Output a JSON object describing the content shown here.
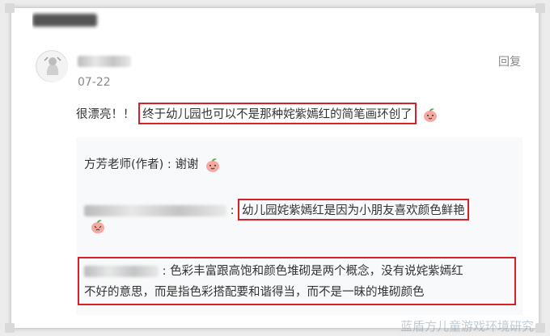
{
  "comment": {
    "reply_link": "回复",
    "date": "07-22",
    "text_prefix": "很漂亮！！",
    "text_highlight": "终于幼儿园也可以不是那种姹紫嫣红的简笔画环创了"
  },
  "replies": [
    {
      "author": "方芳老师(作者)",
      "separator": " : ",
      "text": "谢谢"
    },
    {
      "separator": " : ",
      "text_highlight": "幼儿园姹紫嫣红是因为小朋友喜欢颜色鲜艳"
    },
    {
      "separator": " : ",
      "text_line1": "色彩丰富跟高饱和颜色堆砌是两个概念，没有说姹紫嫣红",
      "text_line2": "不好的意思，而是指色彩搭配要和谐得当，而不是一昧的堆砌颜色"
    }
  ],
  "watermark": "蓝盾方儿童游戏环境研究",
  "colors": {
    "highlight_border": "#d8202a",
    "reply_bg": "#f7f9fa"
  },
  "icons": [
    "peach-emoji-icon",
    "user-avatar-icon"
  ]
}
